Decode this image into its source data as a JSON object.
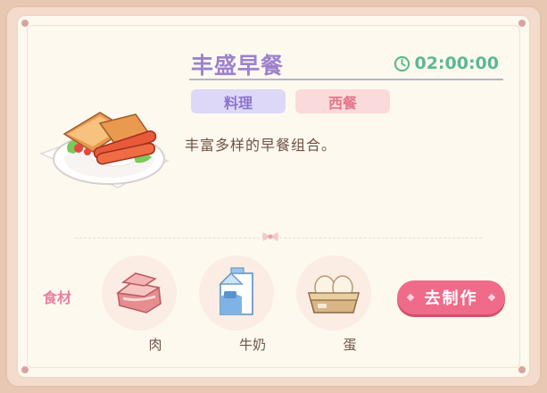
{
  "recipe": {
    "title": "丰盛早餐",
    "timer": "02:00:00",
    "tags": [
      "料理",
      "西餐"
    ],
    "description": "丰富多样的早餐组合。"
  },
  "ingredients": {
    "label": "食材",
    "items": [
      {
        "name": "肉",
        "icon": "meat-icon"
      },
      {
        "name": "牛奶",
        "icon": "milk-carton-icon"
      },
      {
        "name": "蛋",
        "icon": "egg-box-icon"
      }
    ]
  },
  "actions": {
    "make_label": "去制作"
  },
  "colors": {
    "title": "#9d82cc",
    "timer": "#5db892",
    "tag_purple_bg": "#ddd8f7",
    "tag_pink_bg": "#fbdadb",
    "button": "#f06b8a",
    "ingredient_label": "#eb7fa2"
  }
}
